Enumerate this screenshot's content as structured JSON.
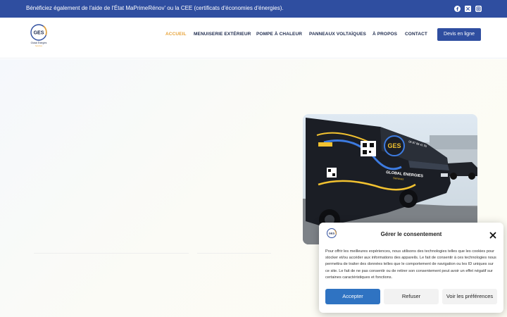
{
  "topbar": {
    "text": "Bénéficiez également de l'aide de l'État MaPrimeRénov' ou la CEE (certificats d'économies d'énergies).",
    "social": [
      "facebook-icon",
      "x-twitter-icon",
      "instagram-icon"
    ]
  },
  "logo": {
    "initials": "GES",
    "name": "Global Énergies",
    "tagline": "Services"
  },
  "nav": {
    "items": [
      "ACCUEIL",
      "MENUISERIE EXTÉRIEUR",
      "POMPE À CHALEUR",
      "PANNEAUX VOLTAÏQUES",
      "À PROPOS",
      "CONTACT"
    ],
    "active_index": 0,
    "cta": "Devis en ligne"
  },
  "hero": {
    "image": "company-van-photo",
    "van_text": "GLOBAL ÉNERGIES",
    "van_subtext": "Services",
    "van_phone": "06 87 88 41 55"
  },
  "consent": {
    "title": "Gérer le consentement",
    "body": "Pour offrir les meilleures expériences, nous utilisons des technologies telles que les cookies pour stocker et/ou accéder aux informations des appareils. Le fait de consentir à ces technologies nous permettra de traiter des données telles que le comportement de navigation ou les ID uniques sur ce site. Le fait de ne pas consentir ou de retirer son consentement peut avoir un effet négatif sur certaines caractéristiques et fonctions.",
    "accept": "Accepter",
    "refuse": "Refuser",
    "preferences": "Voir les préférences"
  },
  "colors": {
    "primary": "#2f4ea0",
    "accent": "#e8a43a",
    "accept_button": "#2f73c2",
    "nav_text": "#1d2a4d"
  }
}
